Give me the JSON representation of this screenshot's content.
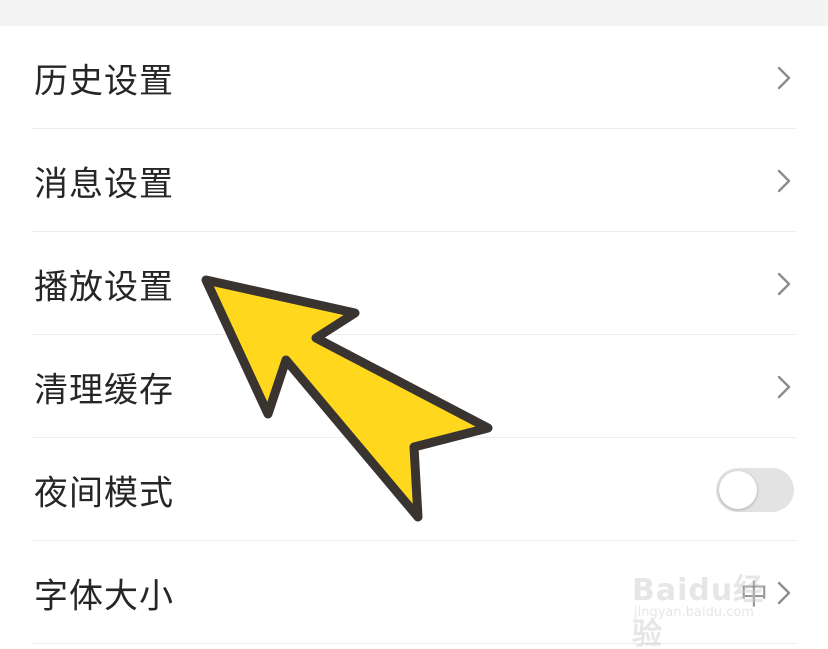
{
  "settings": {
    "items": [
      {
        "label": "历史设置",
        "control": "chevron-right-icon"
      },
      {
        "label": "消息设置",
        "control": "chevron-right-icon"
      },
      {
        "label": "播放设置",
        "control": "chevron-right-icon"
      },
      {
        "label": "清理缓存",
        "control": "chevron-right-icon"
      },
      {
        "label": "夜间模式",
        "control": "toggle",
        "toggle_on": false
      },
      {
        "label": "字体大小",
        "control": "chevron-right-icon",
        "value": "中"
      }
    ]
  },
  "overlay": {
    "annotation": "arrow-pointer",
    "arrow_fill": "#FFD81E",
    "arrow_outline": "#3A3431"
  },
  "watermark": {
    "brand": "Baidu经验",
    "url": "jingyan.baidu.com"
  },
  "colors": {
    "text": "#262626",
    "divider": "#ececec",
    "chevron": "#8c8c8c",
    "toggle_off": "#e3e3e3",
    "top_band": "#f4f4f4"
  }
}
